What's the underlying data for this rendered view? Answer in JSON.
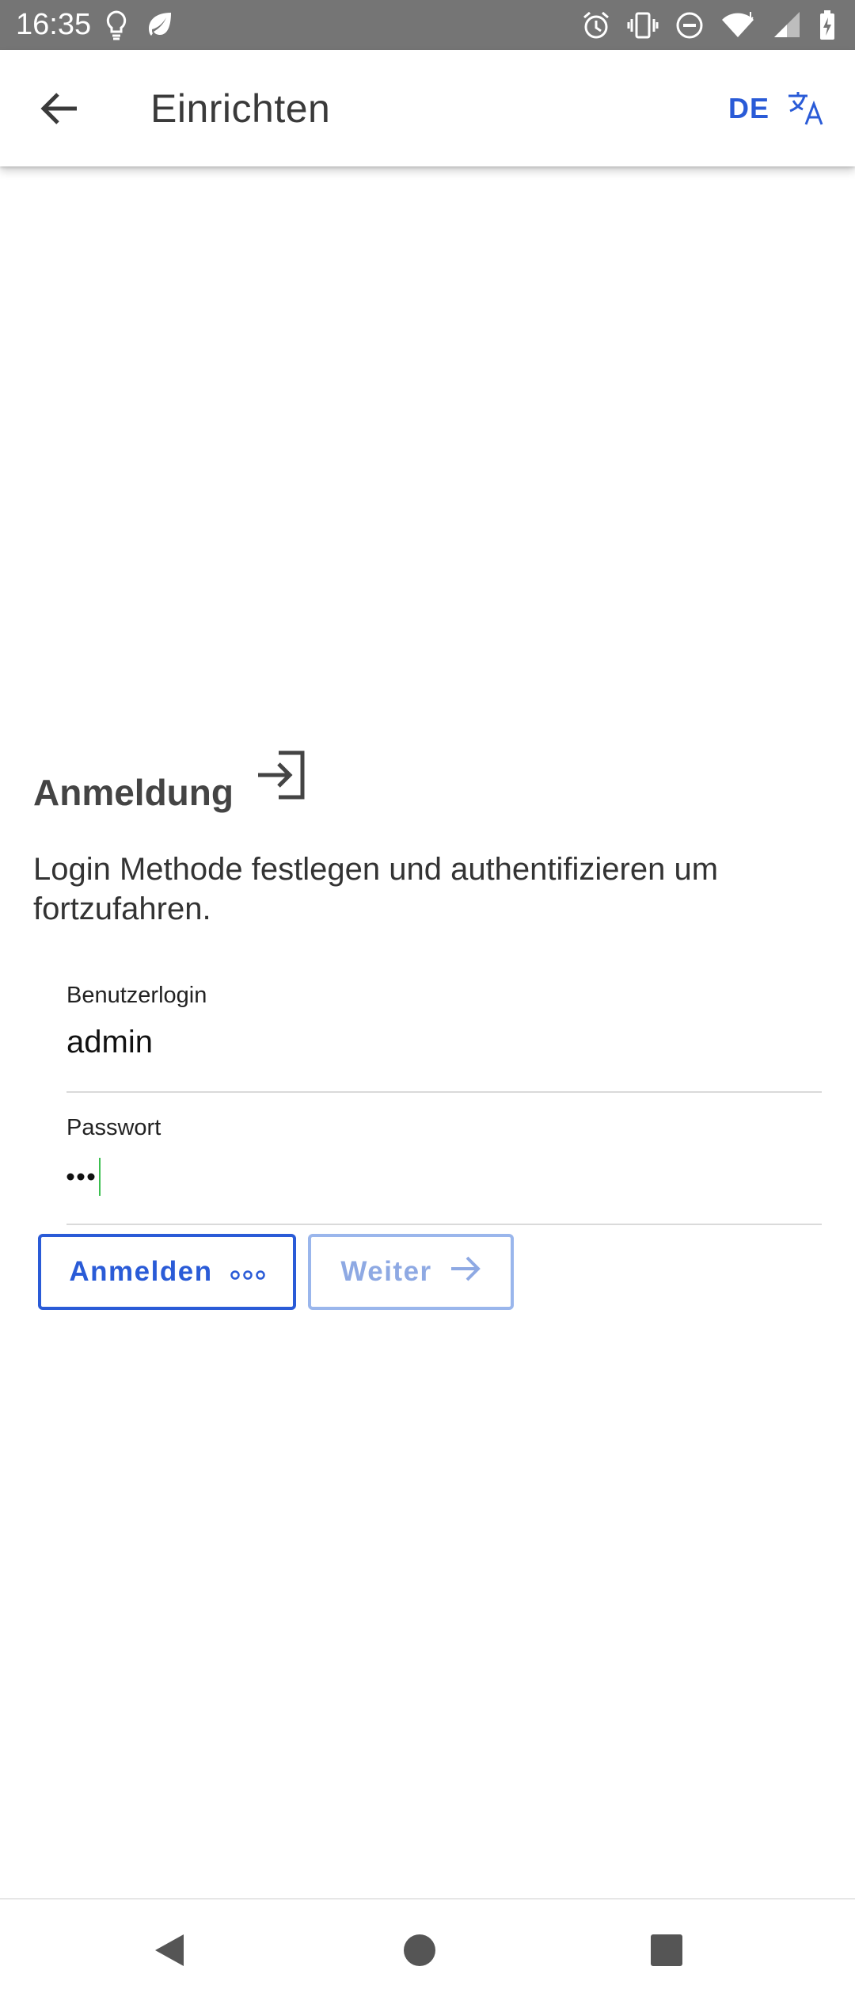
{
  "status_bar": {
    "time": "16:35",
    "left_icons": [
      "lightbulb-icon",
      "leaf-icon"
    ],
    "right_icons": [
      "alarm-icon",
      "vibrate-icon",
      "do-not-disturb-icon",
      "wifi-icon",
      "signal-icon",
      "battery-charging-icon"
    ]
  },
  "app_bar": {
    "title": "Einrichten",
    "back_icon": "arrow-left-icon",
    "language_code": "DE",
    "translate_icon": "translate-icon"
  },
  "content": {
    "heading": "Anmeldung",
    "heading_icon": "login-icon",
    "description": "Login Methode festlegen und authentifizieren um fortzufahren.",
    "username": {
      "label": "Benutzerlogin",
      "value": "admin"
    },
    "password": {
      "label": "Passwort",
      "masked_length": 3
    },
    "buttons": {
      "login_label": "Anmelden",
      "login_icon": "more-dots-icon",
      "next_label": "Weiter",
      "next_icon": "arrow-right-icon"
    }
  },
  "nav_bar": {
    "items": [
      "back-triangle-icon",
      "home-circle-icon",
      "recents-square-icon"
    ]
  },
  "colors": {
    "accent": "#2a5bd7",
    "accent_disabled": "#9ab6ec",
    "status_bar": "#757575",
    "caret": "#3cbf50"
  }
}
